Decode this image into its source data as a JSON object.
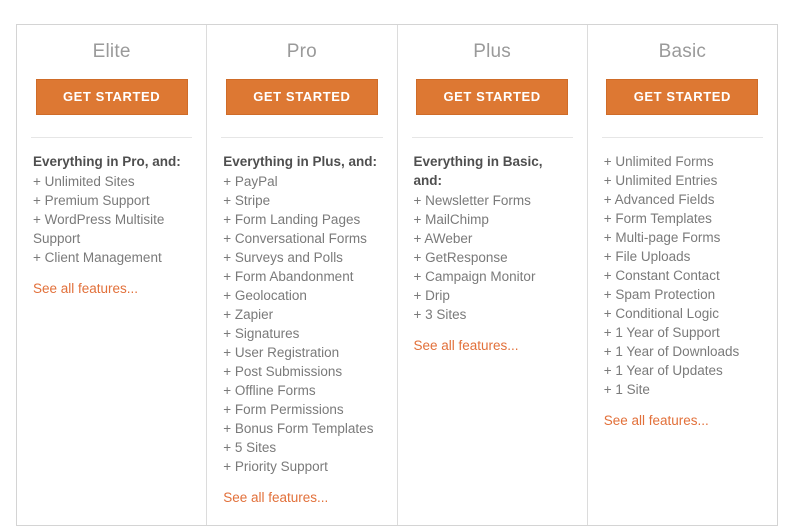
{
  "table": {
    "border_color": "#d4d4d4",
    "accent_color": "#dd7833",
    "link_color": "#e2703a"
  },
  "columns": [
    {
      "title": "Elite",
      "cta_label": "GET STARTED",
      "features_heading": "Everything in Pro, and:",
      "features": [
        "+ Unlimited Sites",
        "+ Premium Support",
        "+ WordPress Multisite Support",
        "+ Client Management"
      ],
      "see_all_label": "See all features..."
    },
    {
      "title": "Pro",
      "cta_label": "GET STARTED",
      "features_heading": "Everything in Plus, and:",
      "features": [
        "+ PayPal",
        "+ Stripe",
        "+ Form Landing Pages",
        "+ Conversational Forms",
        "+ Surveys and Polls",
        "+ Form Abandonment",
        "+ Geolocation",
        "+ Zapier",
        "+ Signatures",
        "+ User Registration",
        "+ Post Submissions",
        "+ Offline Forms",
        "+ Form Permissions",
        "+ Bonus Form Templates",
        "+ 5 Sites",
        "+ Priority Support"
      ],
      "see_all_label": "See all features..."
    },
    {
      "title": "Plus",
      "cta_label": "GET STARTED",
      "features_heading": "Everything in Basic, and:",
      "features": [
        "+ Newsletter Forms",
        "+ MailChimp",
        "+ AWeber",
        "+ GetResponse",
        "+ Campaign Monitor",
        "+ Drip",
        "+ 3 Sites"
      ],
      "see_all_label": "See all features..."
    },
    {
      "title": "Basic",
      "cta_label": "GET STARTED",
      "features_heading": "",
      "features": [
        "+ Unlimited Forms",
        "+ Unlimited Entries",
        "+ Advanced Fields",
        "+ Form Templates",
        "+ Multi-page Forms",
        "+ File Uploads",
        "+ Constant Contact",
        "+ Spam Protection",
        "+ Conditional Logic",
        "+ 1 Year of Support",
        "+ 1 Year of Downloads",
        "+ 1 Year of Updates",
        "+ 1 Site"
      ],
      "see_all_label": "See all features..."
    }
  ]
}
